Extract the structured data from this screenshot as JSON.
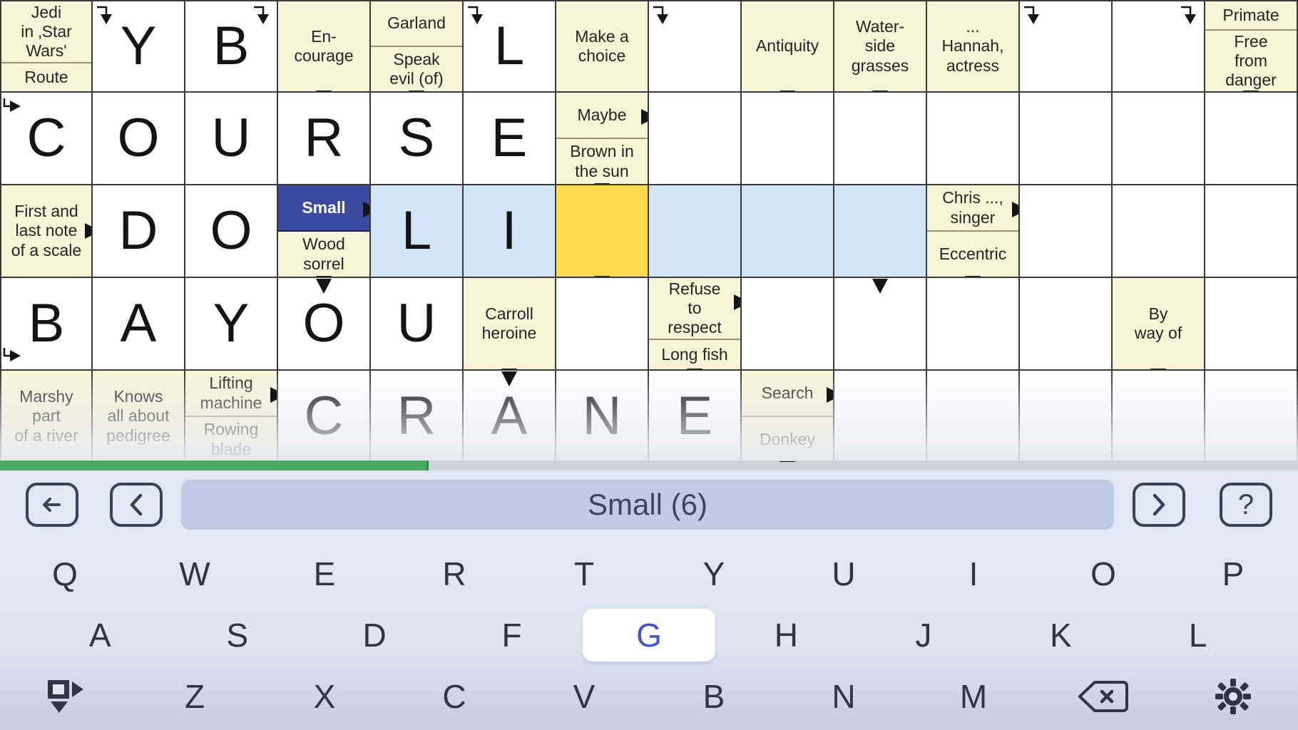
{
  "app": {
    "title": "Crossword Puzzle"
  },
  "colors": {
    "clue_bg": "#f7f4d8",
    "cell_bg": "#ffffff",
    "highlight": "#d3e5f8",
    "cursor": "#fcd94f",
    "active_clue": "#3b4a9e",
    "progress": "#4aab63",
    "key_active_text": "#4256c8",
    "grid_line": "#3a3a3a"
  },
  "grid": {
    "columns": 14,
    "rows": [
      [
        {
          "type": "clue",
          "parts": [
            "Jedi\nin ‚Star\nWars'",
            "Route"
          ],
          "arrows": [
            "right-bottom"
          ]
        },
        {
          "type": "letter",
          "letter": "Y",
          "arrows": [
            "down-topleft"
          ]
        },
        {
          "type": "letter",
          "letter": "B",
          "arrows": [
            "down-topright"
          ]
        },
        {
          "type": "clue",
          "parts": [
            "En-\ncourage"
          ],
          "arrows": [
            "down-bottom"
          ]
        },
        {
          "type": "clue",
          "parts": [
            "Garland",
            "Speak\nevil (of)"
          ],
          "arrows": [
            "down-bottom"
          ]
        },
        {
          "type": "letter",
          "letter": "L",
          "arrows": [
            "down-topleft"
          ]
        },
        {
          "type": "clue",
          "parts": [
            "Make a\nchoice"
          ],
          "arrows": []
        },
        {
          "type": "letter",
          "letter": "",
          "arrows": [
            "down-topleft"
          ]
        },
        {
          "type": "clue",
          "parts": [
            "Antiquity"
          ],
          "arrows": [
            "down-bottom"
          ]
        },
        {
          "type": "clue",
          "parts": [
            "Water-\nside\ngrasses"
          ],
          "arrows": [
            "down-bottom"
          ]
        },
        {
          "type": "clue",
          "parts": [
            "...\nHannah,\nactress"
          ],
          "arrows": []
        },
        {
          "type": "letter",
          "letter": "",
          "arrows": [
            "down-topleft"
          ]
        },
        {
          "type": "letter",
          "letter": "",
          "arrows": [
            "down-topright"
          ]
        },
        {
          "type": "clue",
          "parts": [
            "Primate",
            "Free\nfrom\ndanger"
          ],
          "arrows": [
            "down-bottom"
          ]
        }
      ],
      [
        {
          "type": "letter",
          "letter": "C",
          "arrows": [
            "right-topleft"
          ]
        },
        {
          "type": "letter",
          "letter": "O",
          "arrows": []
        },
        {
          "type": "letter",
          "letter": "U",
          "arrows": []
        },
        {
          "type": "letter",
          "letter": "R",
          "arrows": []
        },
        {
          "type": "letter",
          "letter": "S",
          "arrows": []
        },
        {
          "type": "letter",
          "letter": "E",
          "arrows": []
        },
        {
          "type": "clue",
          "parts": [
            "Maybe",
            "Brown in\nthe sun"
          ],
          "arrows": [
            "right-topright",
            "down-bottom"
          ]
        },
        {
          "type": "letter",
          "letter": "",
          "arrows": []
        },
        {
          "type": "letter",
          "letter": "",
          "arrows": []
        },
        {
          "type": "letter",
          "letter": "",
          "arrows": []
        },
        {
          "type": "letter",
          "letter": "",
          "arrows": []
        },
        {
          "type": "letter",
          "letter": "",
          "arrows": []
        },
        {
          "type": "letter",
          "letter": "",
          "arrows": []
        },
        {
          "type": "letter",
          "letter": "",
          "arrows": []
        }
      ],
      [
        {
          "type": "clue",
          "parts": [
            "First and\nlast note\nof a scale"
          ],
          "arrows": [
            "right-middle"
          ]
        },
        {
          "type": "letter",
          "letter": "D",
          "arrows": []
        },
        {
          "type": "letter",
          "letter": "O",
          "arrows": []
        },
        {
          "type": "clue",
          "parts": [
            "Small",
            "Wood\nsorrel"
          ],
          "active_part": 0,
          "arrows": [
            "right-topright",
            "down-bottom"
          ]
        },
        {
          "type": "letter",
          "letter": "L",
          "state": "highlight",
          "arrows": []
        },
        {
          "type": "letter",
          "letter": "I",
          "state": "highlight",
          "arrows": []
        },
        {
          "type": "letter",
          "letter": "",
          "state": "cursor",
          "arrows": [
            "down-bottom"
          ]
        },
        {
          "type": "letter",
          "letter": "",
          "state": "highlight",
          "arrows": []
        },
        {
          "type": "letter",
          "letter": "",
          "state": "highlight",
          "arrows": []
        },
        {
          "type": "letter",
          "letter": "",
          "state": "highlight",
          "arrows": []
        },
        {
          "type": "clue",
          "parts": [
            "Chris ...,\nsinger",
            "Eccentric"
          ],
          "arrows": [
            "right-topright",
            "down-bottom"
          ]
        },
        {
          "type": "letter",
          "letter": "",
          "arrows": []
        },
        {
          "type": "letter",
          "letter": "",
          "arrows": []
        },
        {
          "type": "letter",
          "letter": "",
          "arrows": []
        }
      ],
      [
        {
          "type": "letter",
          "letter": "B",
          "arrows": [
            "right-bottomleft"
          ]
        },
        {
          "type": "letter",
          "letter": "A",
          "arrows": []
        },
        {
          "type": "letter",
          "letter": "Y",
          "arrows": []
        },
        {
          "type": "letter",
          "letter": "O",
          "arrows": [
            "down-topcenter"
          ]
        },
        {
          "type": "letter",
          "letter": "U",
          "arrows": []
        },
        {
          "type": "clue",
          "parts": [
            "Carroll\nheroine"
          ],
          "arrows": [
            "down-bottom"
          ]
        },
        {
          "type": "letter",
          "letter": "",
          "arrows": []
        },
        {
          "type": "clue",
          "parts": [
            "Refuse\nto\nrespect",
            "Long fish"
          ],
          "arrows": [
            "right-topright",
            "down-bottom"
          ]
        },
        {
          "type": "letter",
          "letter": "",
          "arrows": []
        },
        {
          "type": "letter",
          "letter": "",
          "arrows": [
            "down-topcenter"
          ]
        },
        {
          "type": "letter",
          "letter": "",
          "arrows": []
        },
        {
          "type": "letter",
          "letter": "",
          "arrows": []
        },
        {
          "type": "clue",
          "parts": [
            "By\nway of"
          ],
          "arrows": [
            "down-bottom"
          ]
        },
        {
          "type": "letter",
          "letter": "",
          "arrows": []
        }
      ],
      [
        {
          "type": "clue",
          "parts": [
            "Marshy\npart\nof a river"
          ],
          "arrows": []
        },
        {
          "type": "clue",
          "parts": [
            "Knows\nall about\npedigree"
          ],
          "arrows": []
        },
        {
          "type": "clue",
          "parts": [
            "Lifting\nmachine",
            "Rowing\nblade"
          ],
          "arrows": [
            "right-topright"
          ]
        },
        {
          "type": "letter",
          "letter": "C",
          "arrows": []
        },
        {
          "type": "letter",
          "letter": "R",
          "arrows": []
        },
        {
          "type": "letter",
          "letter": "A",
          "arrows": [
            "down-topcenter"
          ]
        },
        {
          "type": "letter",
          "letter": "N",
          "arrows": []
        },
        {
          "type": "letter",
          "letter": "E",
          "arrows": []
        },
        {
          "type": "clue",
          "parts": [
            "Search",
            "Donkey"
          ],
          "arrows": [
            "right-topright",
            "down-bottom"
          ]
        },
        {
          "type": "letter",
          "letter": "",
          "arrows": []
        },
        {
          "type": "letter",
          "letter": "",
          "arrows": []
        },
        {
          "type": "letter",
          "letter": "",
          "arrows": []
        },
        {
          "type": "letter",
          "letter": "",
          "arrows": []
        },
        {
          "type": "letter",
          "letter": "",
          "arrows": []
        }
      ]
    ]
  },
  "progress": {
    "percent": 33
  },
  "toolbar": {
    "back_label": "back-arrow",
    "prev_label": "chevron-left",
    "clue_text": "Small (6)",
    "next_label": "chevron-right",
    "help_label": "?"
  },
  "keyboard": {
    "row1": [
      "Q",
      "W",
      "E",
      "R",
      "T",
      "Y",
      "U",
      "I",
      "O",
      "P"
    ],
    "row2": [
      "A",
      "S",
      "D",
      "F",
      "G",
      "H",
      "J",
      "K",
      "L"
    ],
    "row3": [
      "Z",
      "X",
      "C",
      "V",
      "B",
      "N",
      "M"
    ],
    "active_key": "G",
    "direction_key": "direction-toggle-icon",
    "backspace_key": "backspace-icon",
    "settings_key": "gear-icon"
  }
}
